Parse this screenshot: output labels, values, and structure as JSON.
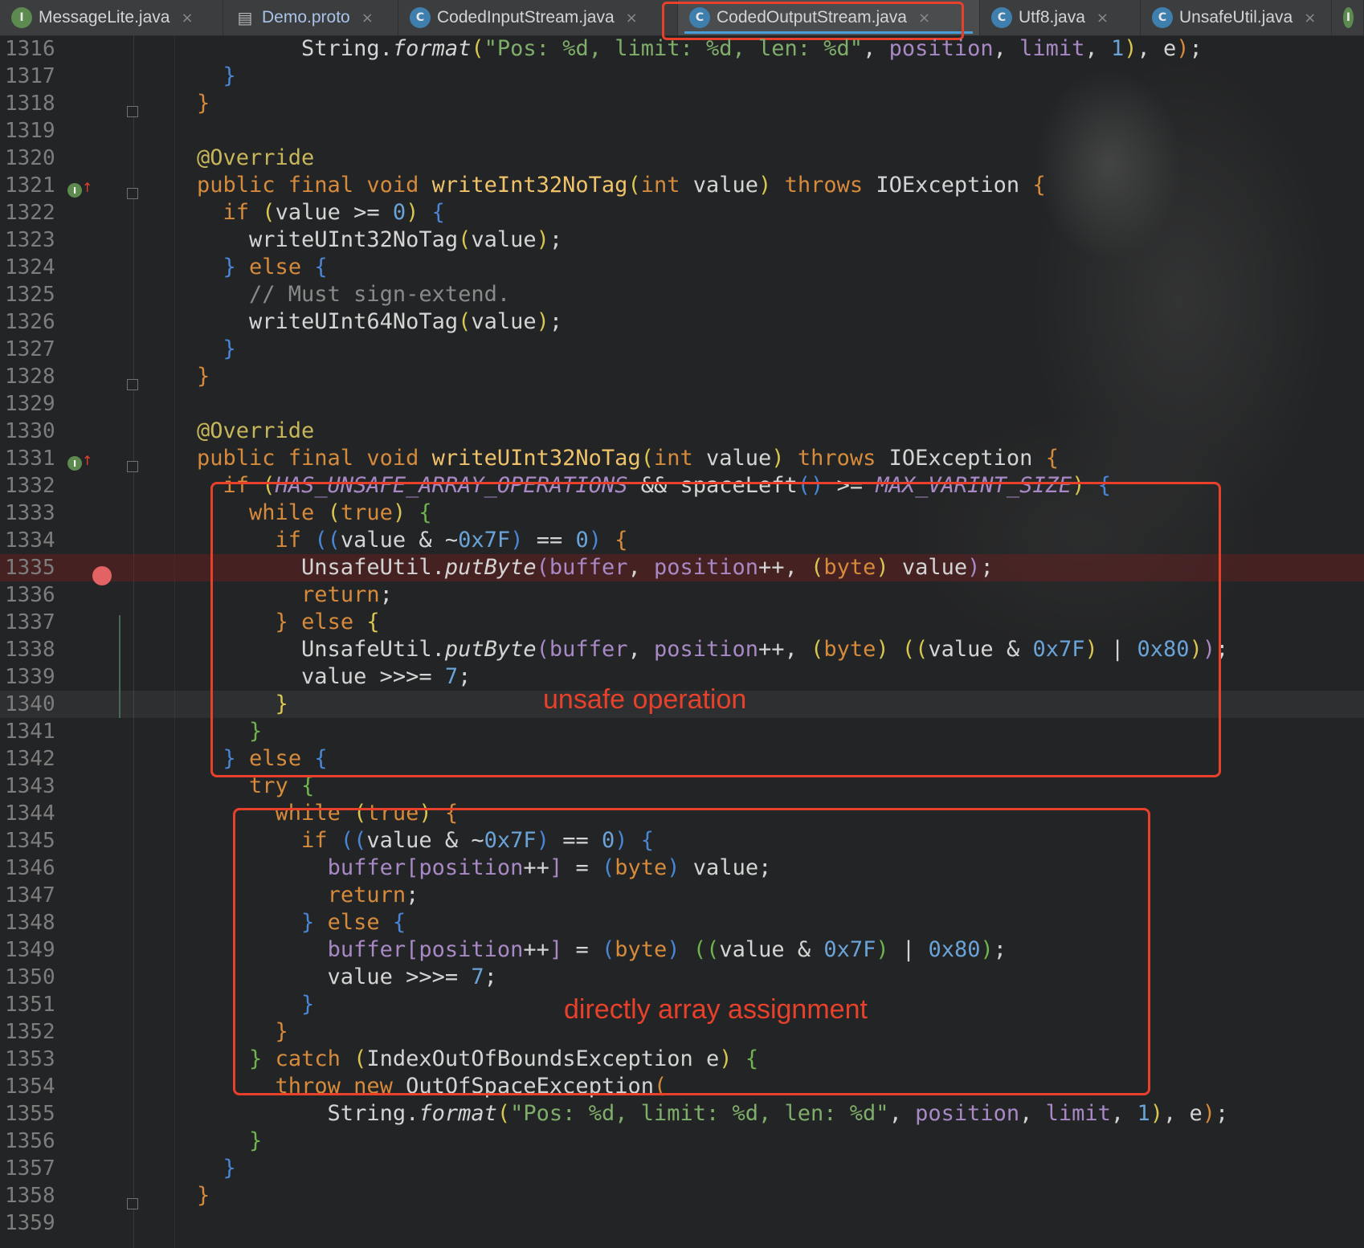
{
  "tabs": [
    {
      "label": "MessageLite.java",
      "icon": "interface-icon",
      "icon_glyph": "I"
    },
    {
      "label": "Demo.proto",
      "icon": "file-icon",
      "icon_glyph": "▤"
    },
    {
      "label": "CodedInputStream.java",
      "icon": "class-icon",
      "icon_glyph": "C"
    },
    {
      "label": "CodedOutputStream.java",
      "icon": "class-icon",
      "icon_glyph": "C",
      "active": true
    },
    {
      "label": "Utf8.java",
      "icon": "class-icon",
      "icon_glyph": "C"
    },
    {
      "label": "UnsafeUtil.java",
      "icon": "class-icon",
      "icon_glyph": "C"
    },
    {
      "label": "",
      "icon": "interface-icon",
      "icon_glyph": "I"
    }
  ],
  "close_glyph": "×",
  "line_numbers": [
    "1316",
    "1317",
    "1318",
    "1319",
    "1320",
    "1321",
    "1322",
    "1323",
    "1324",
    "1325",
    "1326",
    "1327",
    "1328",
    "1329",
    "1330",
    "1331",
    "1332",
    "1333",
    "1334",
    "1335",
    "1336",
    "1337",
    "1338",
    "1339",
    "1340",
    "1341",
    "1342",
    "1343",
    "1344",
    "1345",
    "1346",
    "1347",
    "1348",
    "1349",
    "1350",
    "1351",
    "1352",
    "1353",
    "1354",
    "1355",
    "1356",
    "1357",
    "1358",
    "1359"
  ],
  "annotations": {
    "unsafe": "unsafe operation",
    "direct": "directly array assignment"
  },
  "override_glyph": "I",
  "override_arrow": "↑",
  "colors": {
    "background": "#232425",
    "annotation_red": "#e8412b",
    "keyword": "#d68a3c",
    "string": "#7fae6b",
    "number": "#6aa3d8",
    "field": "#a889c5"
  }
}
